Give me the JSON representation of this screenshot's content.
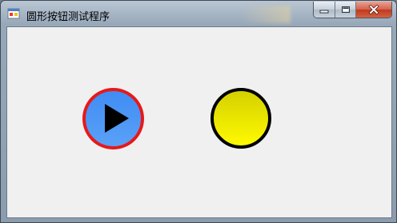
{
  "window": {
    "title": "圆形按钮测试程序",
    "icon": "app-window-icon",
    "controls": {
      "minimize_icon": "minimize-icon",
      "maximize_icon": "maximize-icon",
      "close_icon": "close-icon"
    }
  },
  "buttons": [
    {
      "name": "play-round-button",
      "icon": "play-icon",
      "fill_top": "#3f8cf3",
      "fill_bottom": "#5aa1f7",
      "border_color": "#e81818"
    },
    {
      "name": "yellow-round-button",
      "fill_top": "#d4d000",
      "fill_bottom": "#fffa00",
      "border_color": "#000000"
    }
  ],
  "colors": {
    "client_background": "#f0f0f0",
    "close_button": "#c0391f"
  }
}
